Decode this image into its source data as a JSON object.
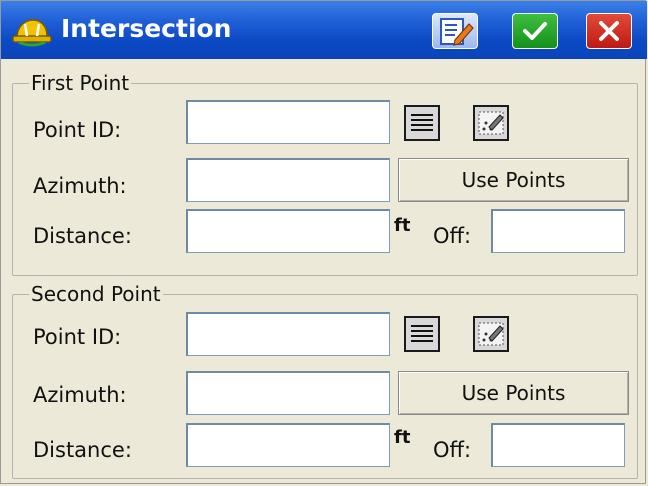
{
  "window": {
    "title": "Intersection",
    "icons": {
      "app": "hardhat-app-icon",
      "edit": "edit-note-icon",
      "ok": "checkmark-icon",
      "close": "close-icon"
    },
    "colors": {
      "titlebar": "#0b4ac4",
      "ok": "#15901a",
      "close": "#c01a12"
    }
  },
  "first_point": {
    "legend": "First Point",
    "point_id_label": "Point ID:",
    "point_id_value": "",
    "azimuth_label": "Azimuth:",
    "azimuth_value": "",
    "use_points_label": "Use Points",
    "distance_label": "Distance:",
    "distance_value": "",
    "unit": "ft",
    "offset_label": "Off:",
    "offset_value": ""
  },
  "second_point": {
    "legend": "Second Point",
    "point_id_label": "Point ID:",
    "point_id_value": "",
    "azimuth_label": "Azimuth:",
    "azimuth_value": "",
    "use_points_label": "Use Points",
    "distance_label": "Distance:",
    "distance_value": "",
    "unit": "ft",
    "offset_label": "Off:",
    "offset_value": ""
  }
}
